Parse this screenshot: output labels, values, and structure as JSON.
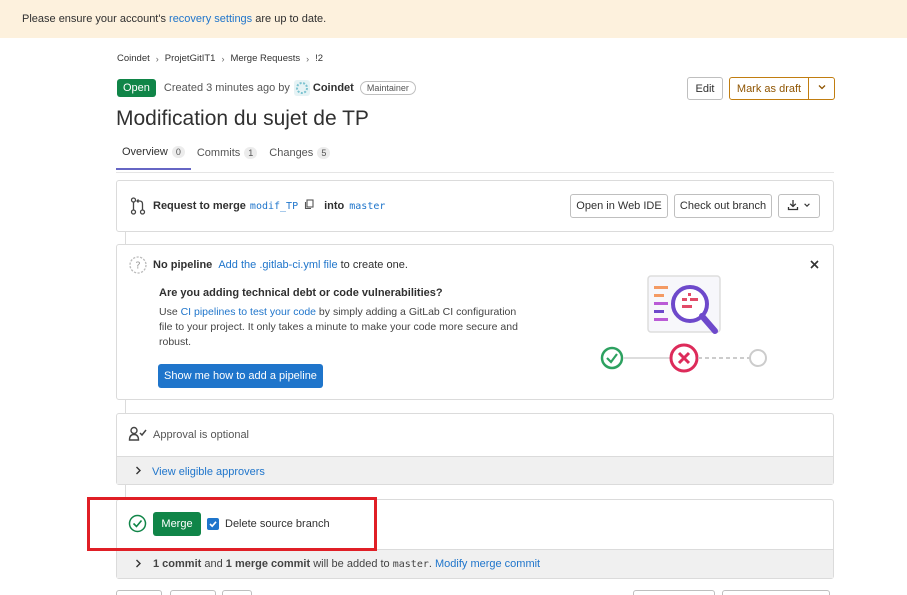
{
  "alert": {
    "prefix": "Please ensure your account's ",
    "link": "recovery settings",
    "suffix": " are up to date."
  },
  "breadcrumb": [
    "Coindet",
    "ProjetGitIT1",
    "Merge Requests",
    "!2"
  ],
  "header": {
    "status": "Open",
    "created": "Created 3 minutes ago by",
    "author": "Coindet",
    "role": "Maintainer",
    "edit_label": "Edit",
    "draft_label": "Mark as draft"
  },
  "title": "Modification du sujet de TP",
  "tabs": [
    {
      "label": "Overview",
      "count": "0"
    },
    {
      "label": "Commits",
      "count": "1"
    },
    {
      "label": "Changes",
      "count": "5"
    }
  ],
  "request": {
    "prefix": "Request to merge",
    "source": "modif_TP",
    "into": "into",
    "target": "master",
    "open_ide": "Open in Web IDE",
    "checkout": "Check out branch"
  },
  "pipeline": {
    "title": "No pipeline",
    "link": "Add the .gitlab-ci.yml file",
    "suffix": "to create one.",
    "heading": "Are you adding technical debt or code vulnerabilities?",
    "body_prefix": "Use ",
    "body_link": "CI pipelines to test your code",
    "body_line1_suffix": " by simply adding a GitLab CI configuration",
    "body_line2": "file to your project. It only takes a minute to make your code more secure and",
    "body_line3": "robust.",
    "button": "Show me how to add a pipeline"
  },
  "approval": {
    "text": "Approval is optional",
    "link": "View eligible approvers"
  },
  "merge": {
    "button": "Merge",
    "delete_label": "Delete source branch",
    "summary_commit": "1 commit",
    "summary_and": "and",
    "summary_merge": "1 merge commit",
    "summary_mid": "will be added to",
    "summary_target": "master",
    "summary_link": "Modify merge commit"
  },
  "colors": {
    "green": "#108548",
    "blue": "#1f75cb",
    "red_highlight": "#e01f26",
    "alert_bg": "#fdf1dd"
  }
}
